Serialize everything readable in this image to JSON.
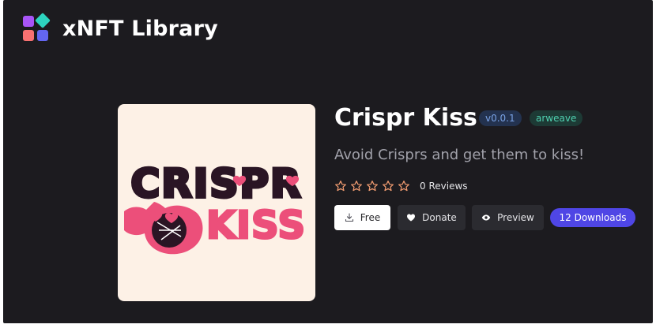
{
  "app": {
    "title": "xNFT Library"
  },
  "item": {
    "name": "Crispr Kiss",
    "version": "v0.0.1",
    "storage": "arweave",
    "description": "Avoid Crisprs and get them to kiss!",
    "rating": {
      "stars": 0,
      "max": 5,
      "reviews_label": "0 Reviews"
    },
    "cover": {
      "line1": "CRISPR",
      "line2": "KISS"
    }
  },
  "actions": {
    "free_label": "Free",
    "donate_label": "Donate",
    "preview_label": "Preview",
    "downloads_label": "12 Downloads"
  },
  "colors": {
    "background": "#1c1b1f",
    "accent": "#4f46e5",
    "star_outline": "#f59e72",
    "cover_bg": "#fdf1e6",
    "cover_dark": "#2a1524",
    "cover_pink": "#ec4f7a"
  }
}
